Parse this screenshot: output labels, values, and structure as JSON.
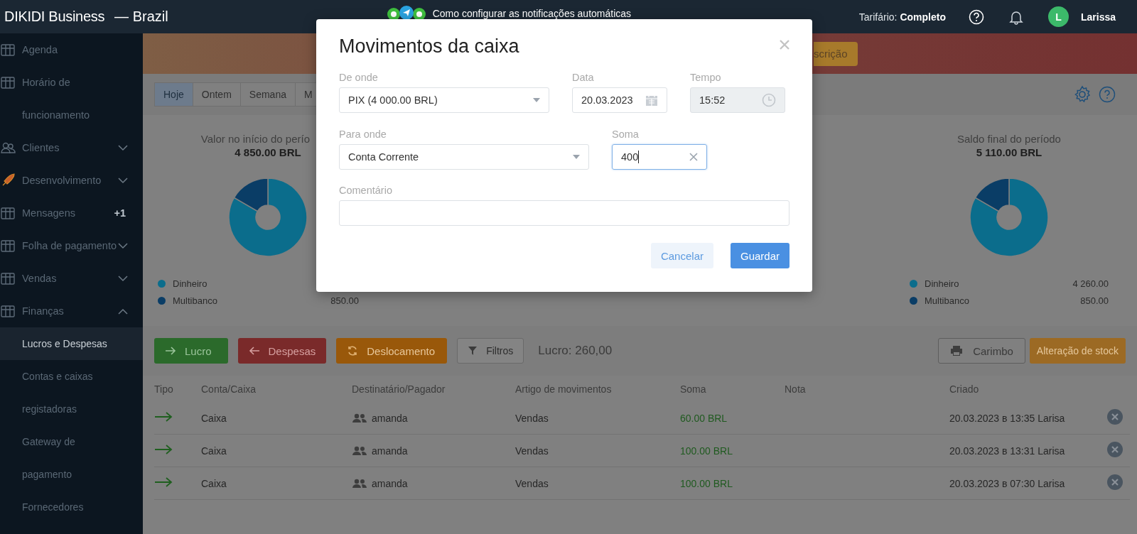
{
  "header": {
    "brand": "DIKIDI Business",
    "region": "— Brazil",
    "notice": "Como configurar as notificações automáticas",
    "plan_label": "Tarifário:",
    "plan": "Completo",
    "user_initial": "L",
    "user_name": "Larissa"
  },
  "sidebar": {
    "items": [
      {
        "label": "Agenda"
      },
      {
        "label": "Horário de funcionamento"
      },
      {
        "label": "Clientes",
        "expanded": false
      },
      {
        "label": "Desenvolvimento",
        "expanded": false
      },
      {
        "label": "Mensagens",
        "badge": "+1"
      },
      {
        "label": "Folha de pagamento",
        "expanded": false
      },
      {
        "label": "Vendas",
        "expanded": false
      },
      {
        "label": "Finanças",
        "expanded": true,
        "children": [
          {
            "label": "Lucros e Despesas",
            "selected": true
          },
          {
            "label": "Contas e caixas registadoras",
            "selected": false
          },
          {
            "label": "Gateway de pagamento",
            "selected": false
          },
          {
            "label": "Fornecedores",
            "selected": false
          }
        ]
      }
    ]
  },
  "banner": {
    "button": "scrição"
  },
  "period_tabs": [
    {
      "label": "Hoje",
      "selected": true
    },
    {
      "label": "Ontem",
      "selected": false
    },
    {
      "label": "Semana",
      "selected": false
    },
    {
      "label": "M",
      "selected": false
    }
  ],
  "stats": [
    {
      "title": "Valor no início do perío",
      "amount": "4 850.00 BRL",
      "legend": [
        {
          "label": "Dinheiro",
          "color": "#0b6d8c"
        },
        {
          "label": "Multibanco",
          "value": "850.00",
          "color": "#0a3d66"
        }
      ]
    },
    {
      "title": "Saldo final do período",
      "amount": "5 110.00 BRL",
      "legend": [
        {
          "label": "Dinheiro",
          "value": "4 260.00",
          "color": "#0b6d8c"
        },
        {
          "label": "Multibanco",
          "value": "850.00",
          "color": "#0a3d66"
        }
      ]
    }
  ],
  "actions": [
    {
      "label": "Lucro",
      "kind": "income"
    },
    {
      "label": "Despesas",
      "kind": "expense"
    },
    {
      "label": "Deslocamento",
      "kind": "transfer"
    },
    {
      "label": "Filtros",
      "kind": "filter"
    }
  ],
  "summary": "Lucro: 260,00",
  "right_actions": [
    {
      "label": "Carimbo",
      "kind": "print"
    },
    {
      "label": "Alteração de stock",
      "kind": "stock"
    }
  ],
  "table": {
    "columns": [
      "Tipo",
      "Conta/Caixa",
      "Destinatário/Pagador",
      "Artigo de movimentos",
      "Soma",
      "Nota",
      "Criado"
    ],
    "rows": [
      {
        "kind": "income",
        "account": "Caixa",
        "payer": "amanda",
        "item": "Vendas",
        "sum": "60.00 BRL",
        "created": "20.03.2023 в 13:35 Larisa"
      },
      {
        "kind": "income",
        "account": "Caixa",
        "payer": "amanda",
        "item": "Vendas",
        "sum": "100.00 BRL",
        "created": "20.03.2023 в 13:31 Larisa"
      },
      {
        "kind": "income",
        "account": "Caixa",
        "payer": "amanda",
        "item": "Vendas",
        "sum": "100.00 BRL",
        "created": "20.03.2023 в 07:30 Larisa"
      }
    ]
  },
  "modal": {
    "title": "Movimentos da caixa",
    "rows": [
      [
        {
          "label": "De onde",
          "value": "PIX (4 000.00 BRL)",
          "kind": "select"
        },
        {
          "label": "Data",
          "value": "20.03.2023",
          "kind": "date"
        },
        {
          "label": "Tempo",
          "value": "15:52",
          "kind": "time",
          "disabled": true
        }
      ],
      [
        {
          "label": "Para onde",
          "value": "Conta Corrente",
          "kind": "select"
        },
        {
          "label": "Soma",
          "value": "400",
          "kind": "amount",
          "focused": true
        }
      ],
      [
        {
          "label": "Comentário",
          "kind": "text"
        }
      ]
    ],
    "buttons": [
      {
        "label": "Cancelar",
        "kind": "secondary"
      },
      {
        "label": "Guardar",
        "kind": "primary"
      }
    ]
  }
}
